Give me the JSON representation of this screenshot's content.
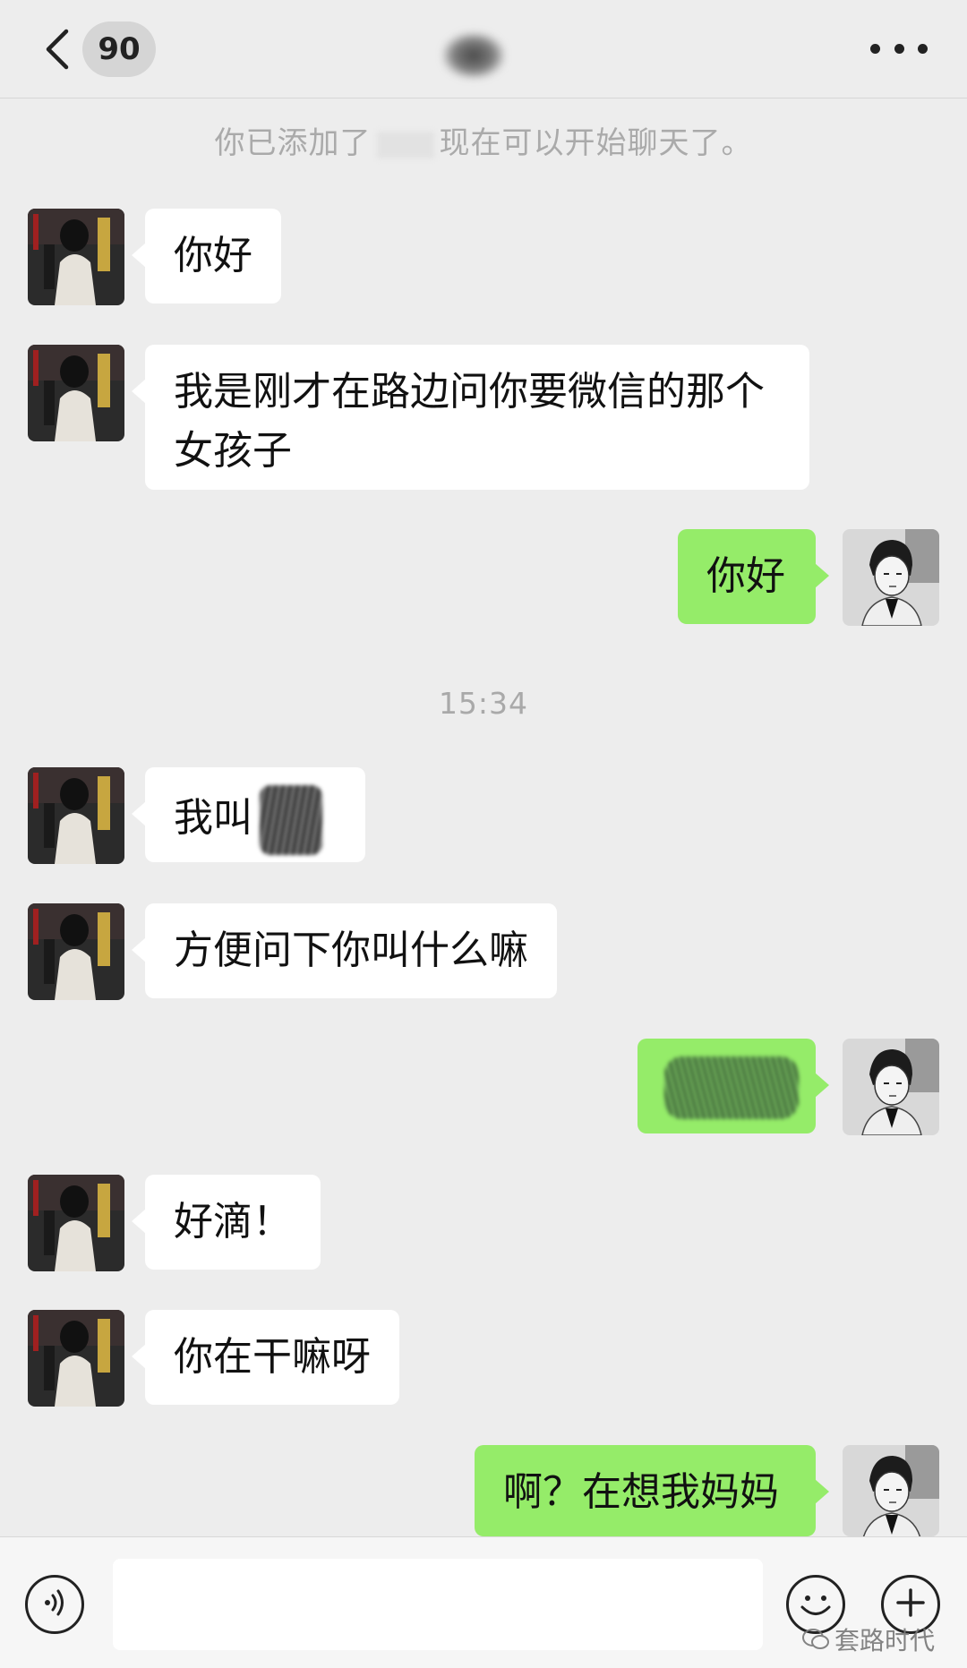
{
  "header": {
    "unread_count": "90",
    "contact_name": "",
    "back_icon": "chevron-left-icon",
    "more_icon": "more-dots-icon"
  },
  "system_notice": {
    "prefix": "你已添加了",
    "suffix": "现在可以开始聊天了。"
  },
  "timestamp": "15:34",
  "messages": [
    {
      "side": "in",
      "text": "你好"
    },
    {
      "side": "in",
      "text": "我是刚才在路边问你要微信的那个女孩子"
    },
    {
      "side": "out",
      "text": "你好"
    },
    {
      "side": "in",
      "text": "我叫"
    },
    {
      "side": "in",
      "text": "方便问下你叫什么嘛"
    },
    {
      "side": "out",
      "text": ""
    },
    {
      "side": "in",
      "text": "好滴！"
    },
    {
      "side": "in",
      "text": "你在干嘛呀"
    },
    {
      "side": "out",
      "text": "啊？在想我妈妈"
    }
  ],
  "input_bar": {
    "voice_icon": "voice-icon",
    "input_value": "",
    "emoji_icon": "emoji-icon",
    "plus_icon": "plus-icon"
  },
  "watermark": "套路时代",
  "colors": {
    "background": "#ededed",
    "incoming_bubble": "#ffffff",
    "outgoing_bubble": "#95ec69",
    "muted_text": "#aaaaaa"
  }
}
